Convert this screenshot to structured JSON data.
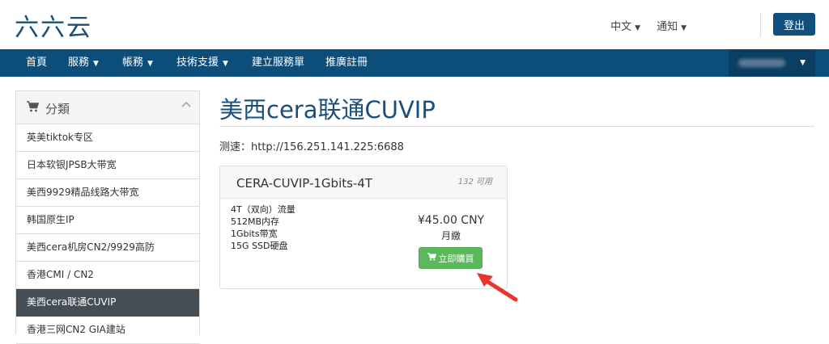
{
  "logo": "六六云",
  "top_links": [
    {
      "label": "中文"
    },
    {
      "label": "通知"
    }
  ],
  "logout_label": "登出",
  "nav": [
    {
      "label": "首頁",
      "has_caret": false
    },
    {
      "label": "服務",
      "has_caret": true
    },
    {
      "label": "帳務",
      "has_caret": true
    },
    {
      "label": "技術支援",
      "has_caret": true
    },
    {
      "label": "建立服務單",
      "has_caret": false
    },
    {
      "label": "推廣註冊",
      "has_caret": false
    }
  ],
  "sidebar": {
    "heading": "分類",
    "items": [
      {
        "label": "英美tiktok专区"
      },
      {
        "label": "日本软银JPSB大带宽"
      },
      {
        "label": "美西9929精品线路大带宽"
      },
      {
        "label": "韩国原生IP"
      },
      {
        "label": "美西cera机房CN2/9929高防"
      },
      {
        "label": "香港CMI / CN2"
      },
      {
        "label": "美西cera联通CUVIP",
        "active": true
      },
      {
        "label": "香港三网CN2 GIA建站"
      }
    ]
  },
  "main": {
    "title": "美西cera联通CUVIP",
    "speed_test": "测速：http://156.251.141.225:6688",
    "product": {
      "name": "CERA-CUVIP-1Gbits-4T",
      "stock": "132 可用",
      "features": [
        "4T（双向）流量",
        "512MB内存",
        "1Gbits带宽",
        "15G SSD硬盘"
      ],
      "price": "¥45.00 CNY",
      "cycle": "月繳",
      "buy_label": "立即購買"
    }
  },
  "colors": {
    "brand": "#0d4d7a",
    "buy": "#5cb85c",
    "active": "#454d55",
    "arrow": "#e8352e"
  }
}
